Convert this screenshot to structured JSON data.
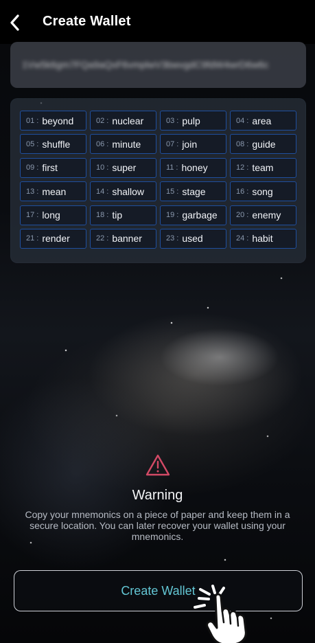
{
  "header": {
    "title": "Create Wallet"
  },
  "seed": {
    "masked_text": "1Vw5k6gm7FQa9aQxF6vmplwV3bwvgdC9fdW4wrD6w6c"
  },
  "mnemonics": [
    {
      "index": "01",
      "word": "beyond"
    },
    {
      "index": "02",
      "word": "nuclear"
    },
    {
      "index": "03",
      "word": "pulp"
    },
    {
      "index": "04",
      "word": "area"
    },
    {
      "index": "05",
      "word": "shuffle"
    },
    {
      "index": "06",
      "word": "minute"
    },
    {
      "index": "07",
      "word": "join"
    },
    {
      "index": "08",
      "word": "guide"
    },
    {
      "index": "09",
      "word": "first"
    },
    {
      "index": "10",
      "word": "super"
    },
    {
      "index": "11",
      "word": "honey"
    },
    {
      "index": "12",
      "word": "team"
    },
    {
      "index": "13",
      "word": "mean"
    },
    {
      "index": "14",
      "word": "shallow"
    },
    {
      "index": "15",
      "word": "stage"
    },
    {
      "index": "16",
      "word": "song"
    },
    {
      "index": "17",
      "word": "long"
    },
    {
      "index": "18",
      "word": "tip"
    },
    {
      "index": "19",
      "word": "garbage"
    },
    {
      "index": "20",
      "word": "enemy"
    },
    {
      "index": "21",
      "word": "render"
    },
    {
      "index": "22",
      "word": "banner"
    },
    {
      "index": "23",
      "word": "used"
    },
    {
      "index": "24",
      "word": "habit"
    }
  ],
  "warning": {
    "title": "Warning",
    "message": "Copy your mnemonics on a piece of paper and keep them in a secure location. You can later recover your wallet using your mnemonics."
  },
  "actions": {
    "create_wallet_label": "Create Wallet"
  },
  "icons": {
    "back": "chevron-left-icon",
    "warning": "warning-triangle-icon",
    "tap": "tap-hand-icon"
  },
  "colors": {
    "accent_text": "#63c6d4",
    "chip_border": "#1f4f9f",
    "warning": "#d34a66"
  }
}
